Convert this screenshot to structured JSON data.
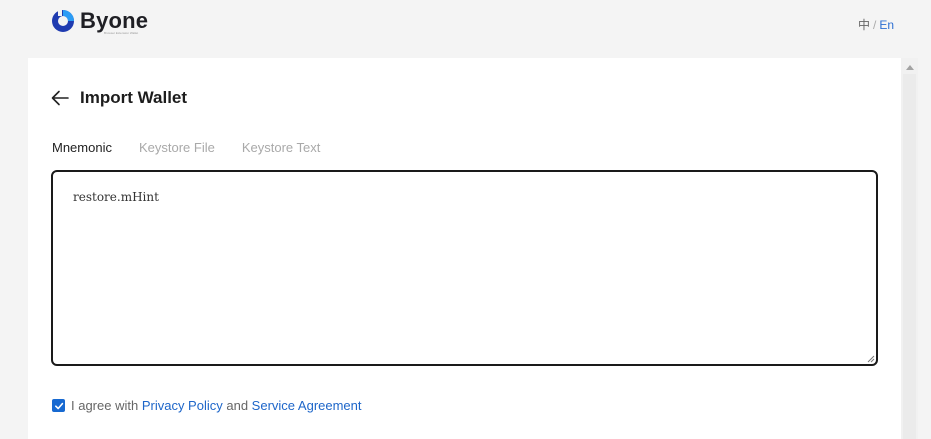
{
  "brand": {
    "name": "Byone",
    "tagline": "Browser Extension Wallet",
    "colors": {
      "mark": "#1f3bb0",
      "mark_accent": "#2b9cf5"
    }
  },
  "language": {
    "zh": "中",
    "separator": "/",
    "en": "En",
    "active": "En"
  },
  "page": {
    "title": "Import Wallet",
    "back_icon": "arrow-left-icon"
  },
  "tabs": [
    {
      "label": "Mnemonic",
      "active": true
    },
    {
      "label": "Keystore File",
      "active": false
    },
    {
      "label": "Keystore Text",
      "active": false
    }
  ],
  "mnemonic_input": {
    "placeholder": "restore.mHint",
    "value": ""
  },
  "agreement": {
    "checked": true,
    "prefix": "I agree with ",
    "privacy_link": "Privacy Policy",
    "conjunction": " and ",
    "service_link": "Service Agreement"
  },
  "accent_color": "#1e66c9"
}
